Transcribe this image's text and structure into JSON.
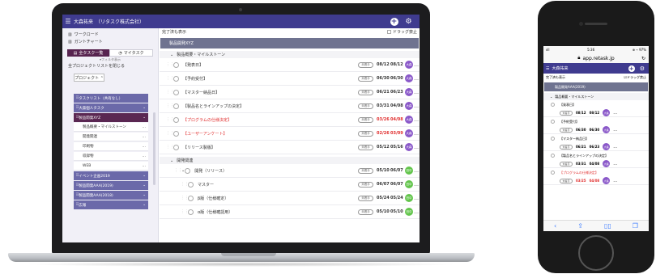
{
  "laptop": {
    "header": {
      "title": "大森祐来　（リタスク株式会社）"
    },
    "sidebar": {
      "links": [
        {
          "icon": "chart-icon",
          "label": "ワークロード"
        },
        {
          "icon": "chart-icon",
          "label": "ガントチャート"
        }
      ],
      "tabs": [
        {
          "label": "全タスク一覧",
          "active": true
        },
        {
          "label": "マイタスク",
          "active": false
        }
      ],
      "filter_label": "▾フィルタ表示",
      "close_all": "全プロジェクトリストを閉じる",
      "project_button": "プロジェクト ⌃",
      "projects": [
        {
          "label": "タスクリスト（共有なし）",
          "style": "a",
          "menu": ""
        },
        {
          "label": "大森個人タスク",
          "style": "b",
          "menu": "⌄"
        },
        {
          "label": "製品開発XYZ",
          "style": "c",
          "menu": "⌄"
        },
        {
          "label": "製品概要・マイルストーン",
          "style": "sub",
          "menu": "…"
        },
        {
          "label": "開発関連",
          "style": "sub",
          "menu": "…"
        },
        {
          "label": "印刷物",
          "style": "sub",
          "menu": "…"
        },
        {
          "label": "収録物",
          "style": "sub",
          "menu": "…"
        },
        {
          "label": "WEB",
          "style": "sub",
          "menu": "…"
        },
        {
          "label": "イベント企画2019",
          "style": "d",
          "menu": "⌄"
        },
        {
          "label": "製品開発AAA(2019)",
          "style": "d",
          "menu": "⌄"
        },
        {
          "label": "製品開発AAA(2018)",
          "style": "d",
          "menu": "⌄"
        },
        {
          "label": "広報",
          "style": "d",
          "menu": "⌄"
        }
      ]
    },
    "main": {
      "show_completed": "完了済も表示",
      "drag_lock": "ドラッグ禁止",
      "project_title": "製品開発XYZ",
      "sections": [
        {
          "title": "製品概要・マイルストーン",
          "tasks": [
            {
              "name": "【発表日】",
              "status": "未着手",
              "start": "08/12",
              "due": "08/12",
              "avatar": "大森",
              "avatar_color": "purple",
              "red": false,
              "indent": 0
            },
            {
              "name": "【予約受付】",
              "status": "未着手",
              "start": "06/30",
              "due": "06/30",
              "avatar": "大森",
              "avatar_color": "purple",
              "red": false,
              "indent": 0
            },
            {
              "name": "【マスター納品日】",
              "status": "未着手",
              "start": "06/21",
              "due": "06/23",
              "avatar": "大森",
              "avatar_color": "purple",
              "red": false,
              "indent": 0
            },
            {
              "name": "【製品名とラインアップの決定】",
              "status": "未着手",
              "start": "03/31",
              "due": "04/08",
              "avatar": "大森",
              "avatar_color": "purple",
              "red": false,
              "indent": 0
            },
            {
              "name": "【プログラムの仕様決定】",
              "status": "未着手",
              "start": "03/26",
              "due": "04/08",
              "avatar": "大森",
              "avatar_color": "purple",
              "red": true,
              "indent": 0
            },
            {
              "name": "【ユーザーアンケート】",
              "status": "未着手",
              "start": "02/26",
              "due": "03/09",
              "avatar": "大森",
              "avatar_color": "purple",
              "red": true,
              "indent": 0
            },
            {
              "name": "【リリース製版】",
              "status": "未着手",
              "start": "05/12",
              "due": "05/16",
              "avatar": "大森",
              "avatar_color": "purple",
              "red": false,
              "indent": 0
            }
          ]
        },
        {
          "title": "開発関連",
          "tasks": [
            {
              "name": "開発（リリース）",
              "status": "未着手",
              "start": "05/10",
              "due": "06/07",
              "avatar": "田中",
              "avatar_color": "green",
              "red": false,
              "indent": 1
            },
            {
              "name": "マスター",
              "status": "未着手",
              "start": "06/07",
              "due": "06/07",
              "avatar": "田中",
              "avatar_color": "green",
              "red": false,
              "indent": 2
            },
            {
              "name": "β版（仕様確定）",
              "status": "未着手",
              "start": "05/24",
              "due": "05/24",
              "avatar": "田中",
              "avatar_color": "green",
              "red": false,
              "indent": 2
            },
            {
              "name": "α版（仕様確認用）",
              "status": "未着手",
              "start": "05/10",
              "due": "05/10",
              "avatar": "田中",
              "avatar_color": "green",
              "red": false,
              "indent": 2
            }
          ]
        }
      ]
    }
  },
  "phone": {
    "status": {
      "carrier": "ııll",
      "time": "5:36",
      "battery": "⊕ ⌁ 97%"
    },
    "url": "app.retask.jp",
    "header_title": "大森祐来",
    "show_completed": "完了済も表示",
    "drag_lock": "ドラッグ禁止",
    "project_title": "製品開発AAA(2019)",
    "section_title": "製品概要・マイルストーン",
    "tasks": [
      {
        "name": "【発表日】",
        "status": "未着手",
        "start": "08/12",
        "due": "08/12",
        "avatar": "大森",
        "red": false
      },
      {
        "name": "【予約受付】",
        "status": "未着手",
        "start": "06/30",
        "due": "06/30",
        "avatar": "大森",
        "red": false
      },
      {
        "name": "【マスター納品日】",
        "status": "未着手",
        "start": "06/21",
        "due": "06/23",
        "avatar": "大森",
        "red": false
      },
      {
        "name": "【製品名とラインアップの決定】",
        "status": "未着手",
        "start": "03/31",
        "due": "04/08",
        "avatar": "大森",
        "red": false
      },
      {
        "name": "【プログラムの仕様決定】",
        "status": "未着手",
        "start": "03/25",
        "due": "04/08",
        "avatar": "大森",
        "red": true
      }
    ],
    "bottom_icons": [
      "back-icon",
      "share-icon",
      "book-icon",
      "tabs-icon"
    ]
  },
  "colors": {
    "brand": "#3f3b8f",
    "active_project": "#57234f",
    "project": "#6b69a9",
    "banner": "#6f7390",
    "overdue": "#e02b2b",
    "avatar_purple": "#8a58c9",
    "avatar_green": "#63c54c"
  }
}
